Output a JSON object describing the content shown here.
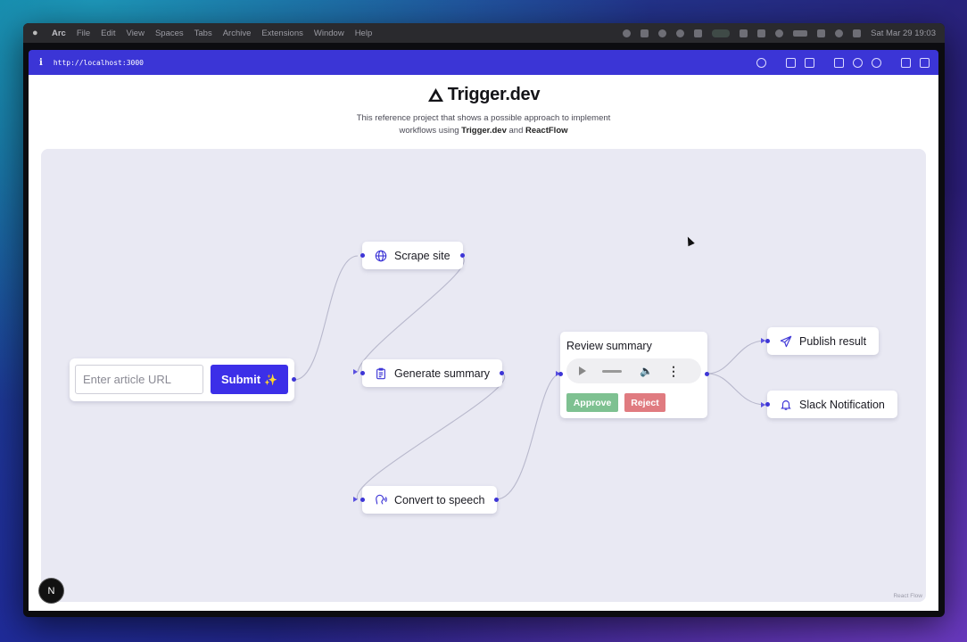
{
  "menubar": {
    "app": "Arc",
    "items": [
      "File",
      "Edit",
      "View",
      "Spaces",
      "Tabs",
      "Archive",
      "Extensions",
      "Window",
      "Help"
    ],
    "clock": "Sat Mar 29  19:03"
  },
  "browser": {
    "url": "http://localhost:3000"
  },
  "header": {
    "brand": "Trigger.dev",
    "subtitle_line1": "This reference project that shows a possible approach to implement",
    "subtitle_line2_prefix": "workflows using ",
    "subtitle_brand1": "Trigger.dev",
    "subtitle_and": " and ",
    "subtitle_brand2": "ReactFlow"
  },
  "flow": {
    "input_placeholder": "Enter article URL",
    "submit_label": "Submit",
    "submit_sparkle": "✨",
    "nodes": {
      "scrape": "Scrape site",
      "summary": "Generate summary",
      "speech": "Convert to speech",
      "review_title": "Review summary",
      "approve": "Approve",
      "reject": "Reject",
      "publish": "Publish result",
      "slack": "Slack Notification"
    },
    "attribution": "React Flow",
    "badge": "N"
  },
  "colors": {
    "accent": "#3c2fe8",
    "browser_bar": "#3b35d6",
    "canvas": "#e9e9f3",
    "approve": "#7ec191",
    "reject": "#e07b80"
  }
}
